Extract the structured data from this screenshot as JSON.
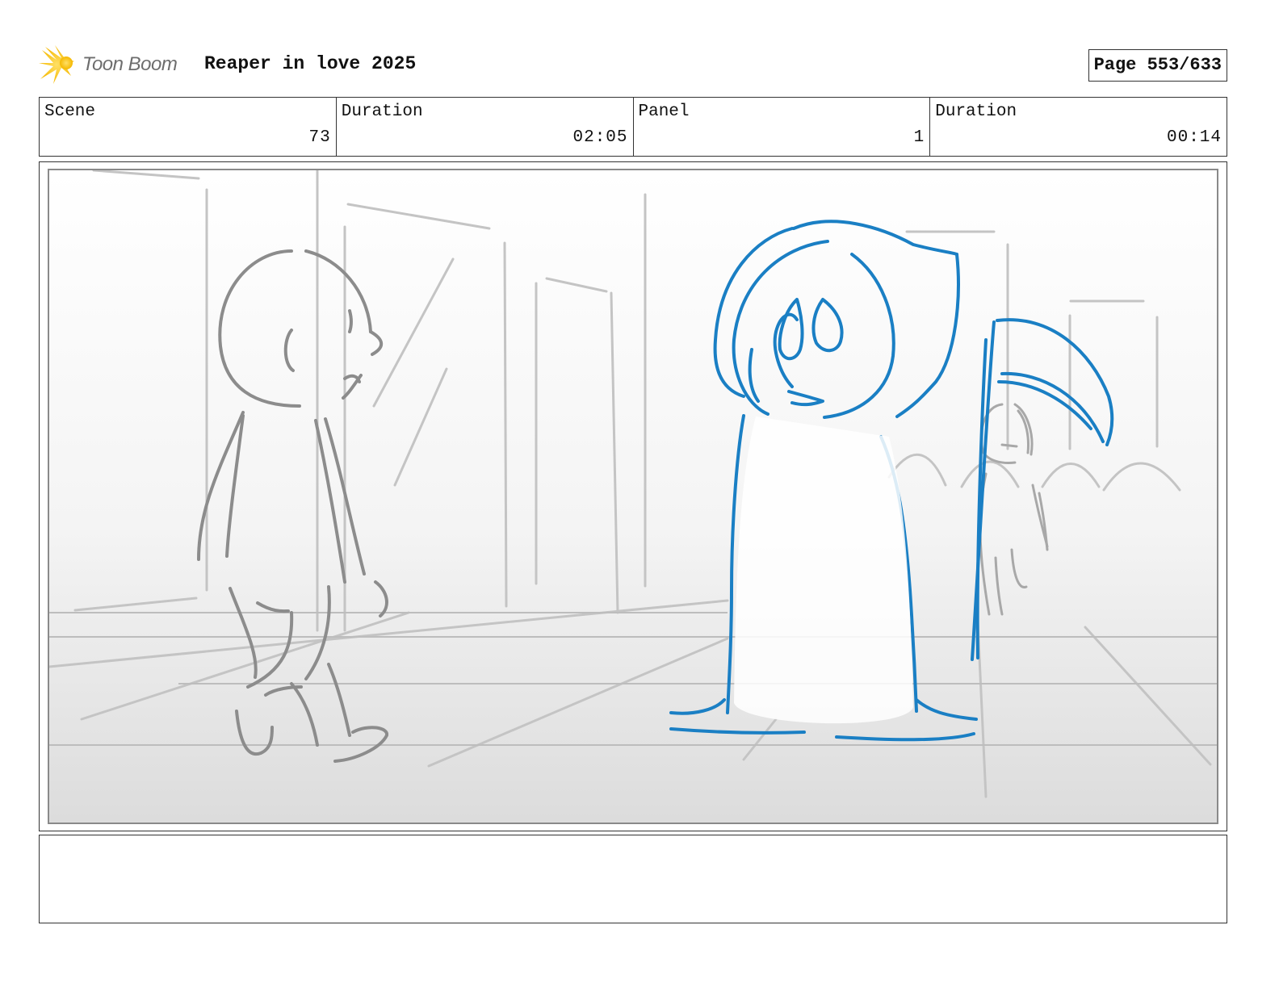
{
  "header": {
    "logo_text": "Toon Boom",
    "project_title": "Reaper in love 2025",
    "page_label": "Page 553/633"
  },
  "info": [
    {
      "label": "Scene",
      "value": "73"
    },
    {
      "label": "Duration",
      "value": "02:05"
    },
    {
      "label": "Panel",
      "value": "1"
    },
    {
      "label": "Duration",
      "value": "00:14"
    }
  ],
  "panel": {
    "sketch_color": "#8c8c8c",
    "reaper_color": "#1a7fc4"
  },
  "notes": {
    "text": ""
  }
}
